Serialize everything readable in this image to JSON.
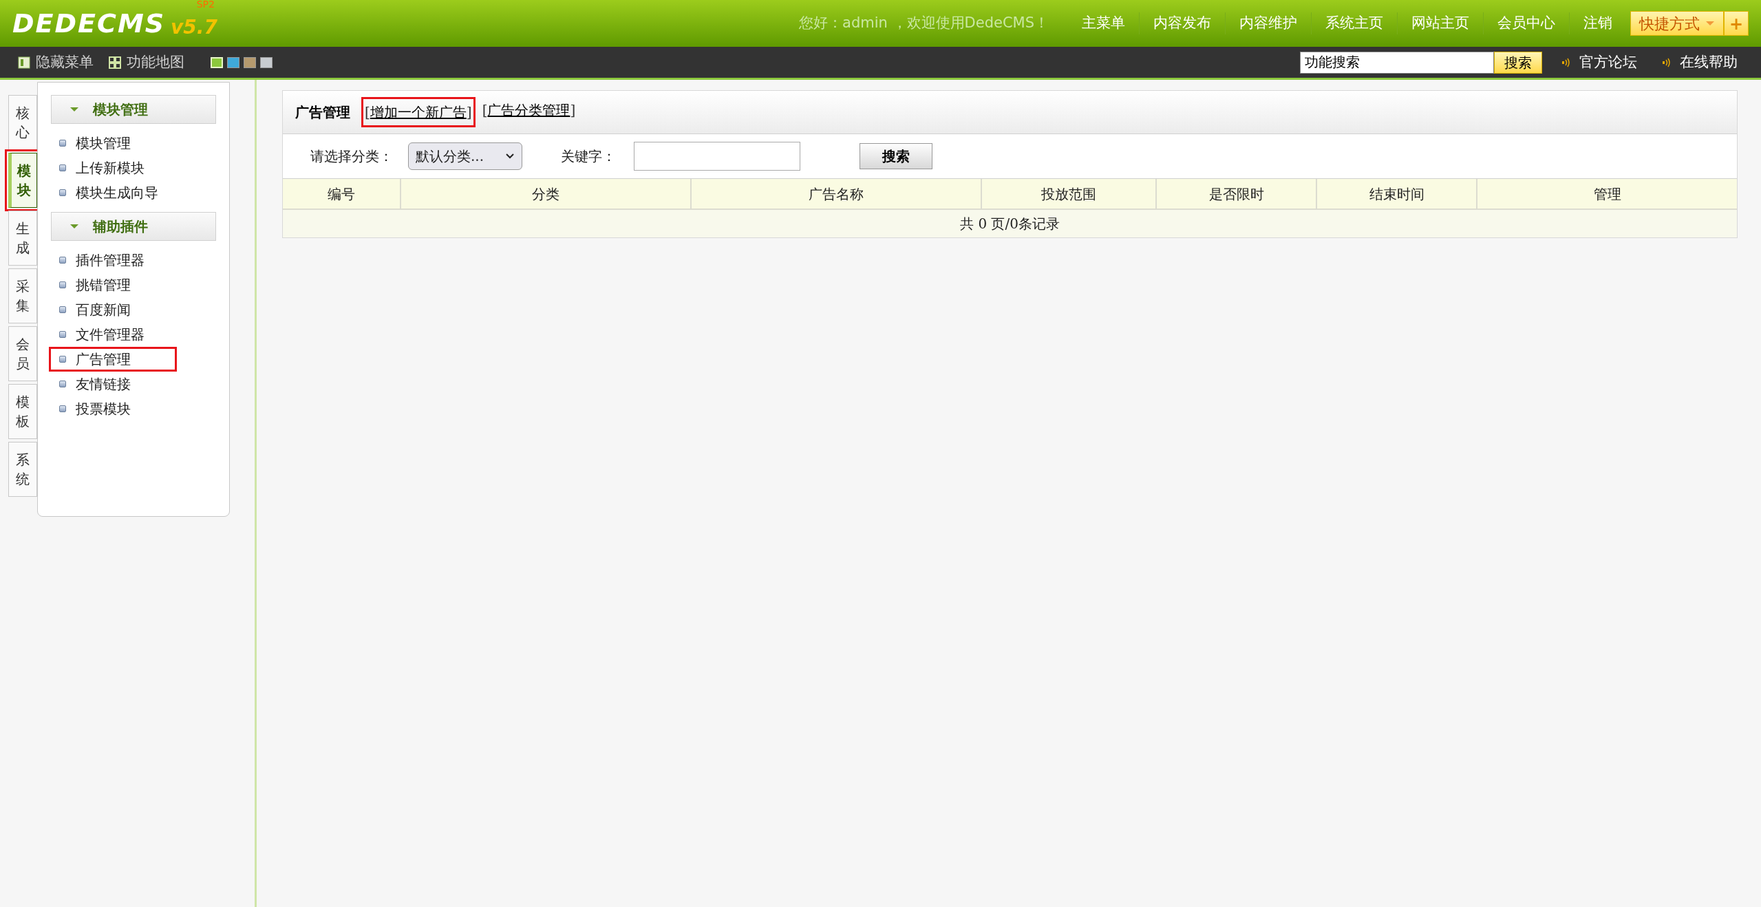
{
  "header": {
    "logo": "DEDECMS",
    "version": "v5.7",
    "edition": "SP2",
    "greeting": "您好：admin ，欢迎使用DedeCMS！",
    "nav": [
      "主菜单",
      "内容发布",
      "内容维护",
      "系统主页",
      "网站主页",
      "会员中心",
      "注销"
    ],
    "shortcut": "快捷方式",
    "shortcut_add": "+"
  },
  "toolbar": {
    "items": [
      {
        "label": "隐藏菜单",
        "kind": "panel"
      },
      {
        "label": "功能地图",
        "kind": "grid"
      }
    ],
    "skins": [
      {
        "color": "#8cc83c",
        "selected": true
      },
      {
        "color": "#3fa9d9",
        "selected": false
      },
      {
        "color": "#b59a6e",
        "selected": false
      },
      {
        "color": "#c8ccd0",
        "selected": false
      }
    ],
    "search": {
      "value": "功能搜索",
      "button": "搜索"
    },
    "links": [
      "官方论坛",
      "在线帮助"
    ]
  },
  "side_tabs": [
    {
      "label": "核心",
      "selected": false,
      "highlighted": false
    },
    {
      "label": "模块",
      "selected": true,
      "highlighted": true
    },
    {
      "label": "生成",
      "selected": false,
      "highlighted": false
    },
    {
      "label": "采集",
      "selected": false,
      "highlighted": false
    },
    {
      "label": "会员",
      "selected": false,
      "highlighted": false
    },
    {
      "label": "模板",
      "selected": false,
      "highlighted": false
    },
    {
      "label": "系统",
      "selected": false,
      "highlighted": false
    }
  ],
  "menu_groups": [
    {
      "title": "模块管理",
      "expanded": true,
      "items": [
        {
          "label": "模块管理",
          "highlighted": false
        },
        {
          "label": "上传新模块",
          "highlighted": false
        },
        {
          "label": "模块生成向导",
          "highlighted": false
        }
      ]
    },
    {
      "title": "辅助插件",
      "expanded": true,
      "items": [
        {
          "label": "插件管理器",
          "highlighted": false
        },
        {
          "label": "挑错管理",
          "highlighted": false
        },
        {
          "label": "百度新闻",
          "highlighted": false
        },
        {
          "label": "文件管理器",
          "highlighted": false
        },
        {
          "label": "广告管理",
          "highlighted": true
        },
        {
          "label": "友情链接",
          "highlighted": false
        },
        {
          "label": "投票模块",
          "highlighted": false
        }
      ]
    }
  ],
  "content": {
    "title": "广告管理",
    "bracket_open": "[",
    "bracket_close": "]",
    "links": [
      {
        "label": "增加一个新广告",
        "highlighted": true
      },
      {
        "label": "广告分类管理",
        "highlighted": false
      }
    ],
    "filter": {
      "category_label": "请选择分类：",
      "category_value": "默认分类...",
      "keyword_label": "关键字：",
      "button": "搜索"
    },
    "table": {
      "columns": [
        "编号",
        "分类",
        "广告名称",
        "投放范围",
        "是否限时",
        "结束时间",
        "管理"
      ],
      "footer": "共 0 页/0条记录"
    }
  }
}
